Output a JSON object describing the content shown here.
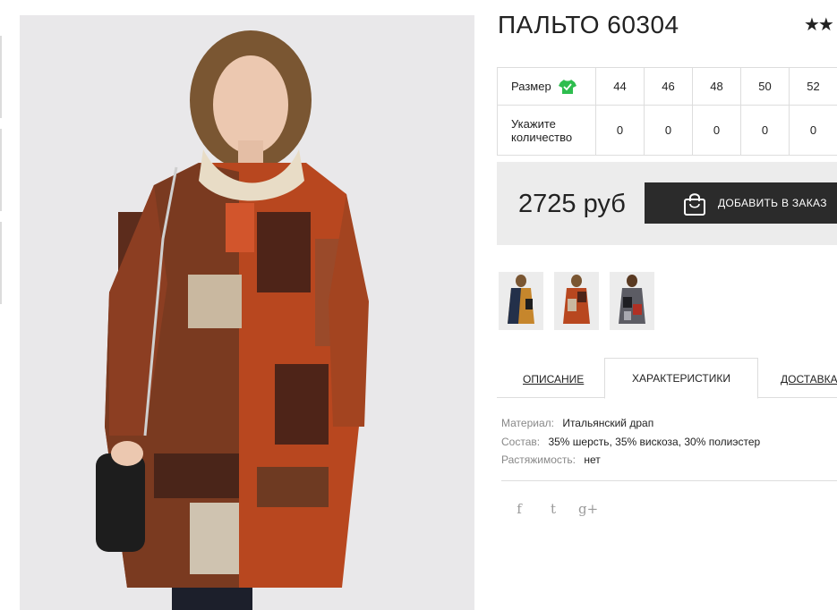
{
  "product": {
    "title": "ПАЛЬТО 60304",
    "rating_stars": "★★",
    "price": "2725 руб",
    "add_button_label": "ДОБАВИТЬ В ЗАКАЗ"
  },
  "size_table": {
    "size_label": "Размер",
    "quantity_label": "Укажите количество",
    "sizes": [
      "44",
      "46",
      "48",
      "50",
      "52"
    ],
    "quantities": [
      "0",
      "0",
      "0",
      "0",
      "0"
    ]
  },
  "tabs": [
    {
      "label": "ОПИСАНИЕ",
      "active": false
    },
    {
      "label": "ХАРАКТЕРИСТИКИ",
      "active": true
    },
    {
      "label": "ДОСТАВКА",
      "active": false
    }
  ],
  "specs": [
    {
      "key": "Материал:",
      "value": "Итальянский драп"
    },
    {
      "key": "Состав:",
      "value": "35% шерсть, 35% вискоза, 30% полиэстер"
    },
    {
      "key": "Растяжимость:",
      "value": "нет"
    }
  ],
  "social": {
    "facebook": "f",
    "twitter": "t",
    "googleplus": "g+"
  },
  "colors": {
    "accent_green": "#2ebd4e",
    "button_dark": "#2b2b2b",
    "coat_rust": "#b8471f",
    "coat_brown": "#5a2d1e"
  }
}
